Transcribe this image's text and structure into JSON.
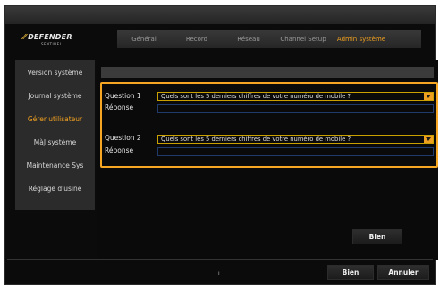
{
  "brand": {
    "logo_text": "DEFENDER",
    "logo_subtext": "SENTINEL"
  },
  "tabs": [
    {
      "label": "Général"
    },
    {
      "label": "Record"
    },
    {
      "label": "Réseau"
    },
    {
      "label": "Channel Setup"
    },
    {
      "label": "Admin système",
      "active": true
    }
  ],
  "sidebar": {
    "items": [
      {
        "label": "Version système"
      },
      {
        "label": "Journal système"
      },
      {
        "label": "Gérer utilisateur",
        "active": true
      },
      {
        "label": "MàJ système"
      },
      {
        "label": "Maintenance Sys"
      },
      {
        "label": "Réglage d'usine"
      }
    ]
  },
  "form": {
    "q1_label": "Question 1",
    "q1_value": "Quels sont les 5 derniers chiffres de votre numéro de mobile ?",
    "a1_label": "Réponse",
    "a1_value": "",
    "q2_label": "Question 2",
    "q2_value": "Quels sont les 5 derniers chiffres de votre numéro de mobile ?",
    "a2_label": "Réponse",
    "a2_value": ""
  },
  "buttons": {
    "ok_inner": "Bien",
    "ok_footer": "Bien",
    "cancel": "Annuler"
  },
  "footer": {
    "page_mark": "ı"
  },
  "colors": {
    "accent": "#f0a020",
    "highlight": "#f5a623",
    "field_border": "#1f3a6b"
  }
}
